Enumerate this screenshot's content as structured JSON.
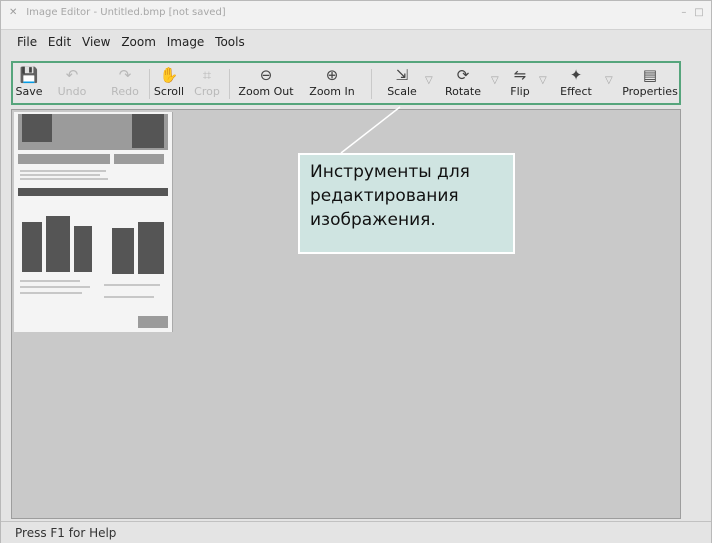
{
  "window": {
    "title": "Image Editor - Untitled.bmp [not saved]"
  },
  "menubar": {
    "items": [
      "File",
      "Edit",
      "View",
      "Zoom",
      "Image",
      "Tools"
    ]
  },
  "toolbar": {
    "save": "Save",
    "undo": "Undo",
    "redo": "Redo",
    "scroll": "Scroll",
    "crop": "Crop",
    "zoom_out": "Zoom Out",
    "zoom_in": "Zoom In",
    "scale": "Scale",
    "rotate": "Rotate",
    "flip": "Flip",
    "effect": "Effect",
    "properties": "Properties"
  },
  "callout": {
    "lines": [
      "Инструменты для",
      "редактирования",
      "изображения."
    ]
  },
  "statusbar": {
    "text": "Press F1 for Help"
  },
  "colors": {
    "toolbar_outline": "#56a57c",
    "callout_bg": "#cfe4e1",
    "canvas_bg": "#c9c9c9"
  },
  "icons": {
    "save": "floppy-disk-icon",
    "undo": "undo-arrow-icon",
    "redo": "redo-arrow-icon",
    "scroll": "hand-scroll-icon",
    "crop": "crop-icon",
    "zoom_out": "zoom-out-icon",
    "zoom_in": "zoom-in-icon",
    "scale": "scale-icon",
    "rotate": "rotate-icon",
    "flip": "flip-icon",
    "effect": "effect-icon",
    "properties": "properties-icon"
  }
}
